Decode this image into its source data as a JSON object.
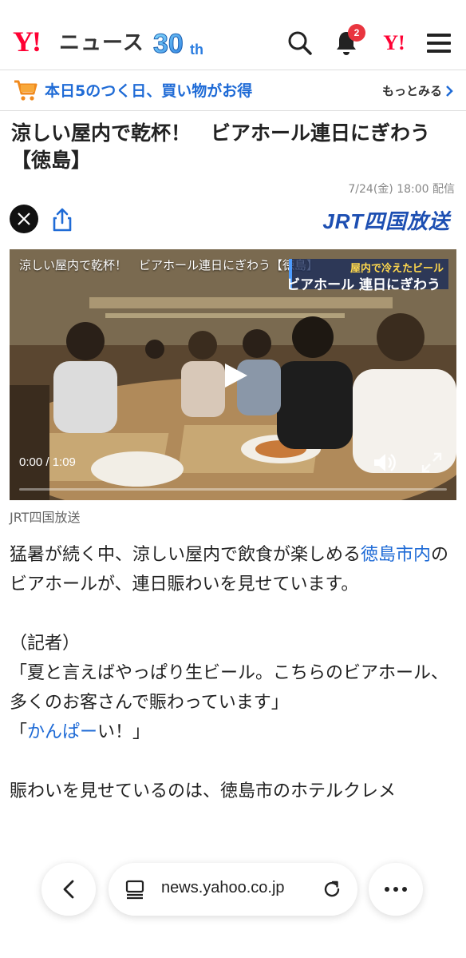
{
  "header": {
    "logo_y": "Y!",
    "logo_news": "ニュース",
    "logo_30": "30",
    "logo_th": "th",
    "notification_count": "2",
    "yahoo_icon": "Y!"
  },
  "promo": {
    "text": "本日5のつく日、買い物がお得",
    "more": "もっとみる"
  },
  "article": {
    "title": "涼しい屋内で乾杯！　ビアホール連日にぎわう【徳島】",
    "date": "7/24(金) 18:00 配信",
    "publisher_logo": "JRT四国放送",
    "video": {
      "title": "涼しい屋内で乾杯！　ビアホール連日にぎわう【徳島】",
      "caption_small": "屋内で冷えたビール",
      "caption_big": "ビアホール 連日にぎわう",
      "time": "0:00 / 1:09",
      "progress": 0
    },
    "source": "JRT四国放送",
    "p1_a": "猛暑が続く中、涼しい屋内で飲食が楽しめる",
    "p1_link": "徳島市内",
    "p1_b": "のビアホールが、連日賑わいを見せています。",
    "p2": "（記者）",
    "p3": "「夏と言えばやっぱり生ビール。こちらのビアホール、多くのお客さんで賑わっています」",
    "p4_a": "「",
    "p4_link": "かんぱー",
    "p4_b": "い！」",
    "p5": "賑わいを見せているのは、徳島市のホテルクレメ"
  },
  "browser": {
    "url": "news.yahoo.co.jp"
  },
  "colors": {
    "brand_red": "#ff0033",
    "link_blue": "#1f6bd6",
    "badge_red": "#e9353f",
    "jrt_blue": "#1d4fb2"
  }
}
